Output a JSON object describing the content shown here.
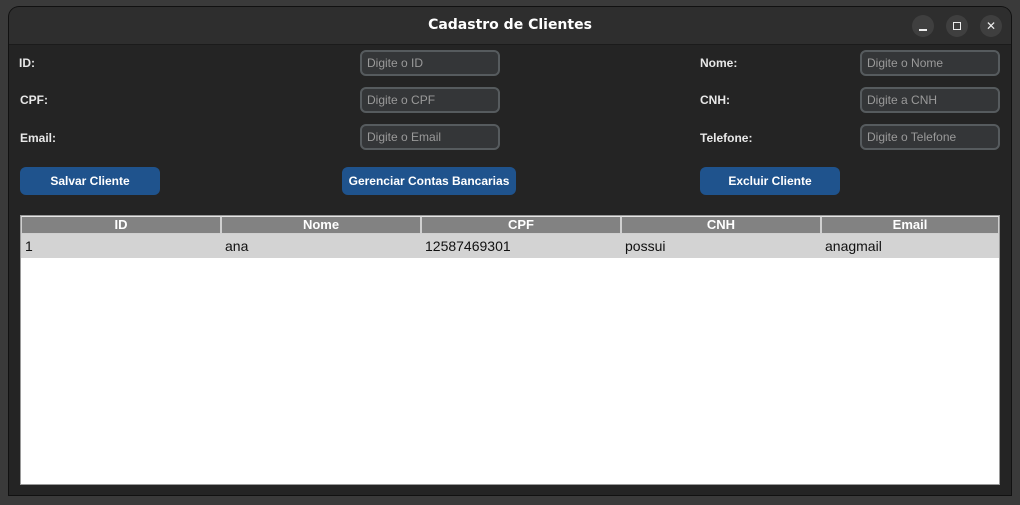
{
  "window": {
    "title": "Cadastro de Clientes",
    "controls": {
      "minimize": "minimize-icon",
      "maximize": "maximize-icon",
      "close": "✕"
    }
  },
  "form": {
    "id_label": "ID:",
    "id_placeholder": "Digite o ID",
    "nome_label": "Nome:",
    "nome_placeholder": "Digite o Nome",
    "cpf_label": "CPF:",
    "cpf_placeholder": "Digite o CPF",
    "cnh_label": "CNH:",
    "cnh_placeholder": "Digite a CNH",
    "email_label": "Email:",
    "email_placeholder": "Digite o Email",
    "telefone_label": "Telefone:",
    "telefone_placeholder": "Digite o Telefone"
  },
  "actions": {
    "save": "Salvar Cliente",
    "manage_accounts": "Gerenciar Contas Bancarias",
    "delete": "Excluir Cliente"
  },
  "table": {
    "columns": [
      "ID",
      "Nome",
      "CPF",
      "CNH",
      "Email"
    ],
    "rows": [
      [
        "1",
        "ana",
        "12587469301",
        "possui",
        "anagmail"
      ]
    ]
  },
  "colors": {
    "button": "#1f538d",
    "window_bg": "#242424",
    "header_bg": "#828282",
    "row_selected": "#d3d3d3"
  }
}
